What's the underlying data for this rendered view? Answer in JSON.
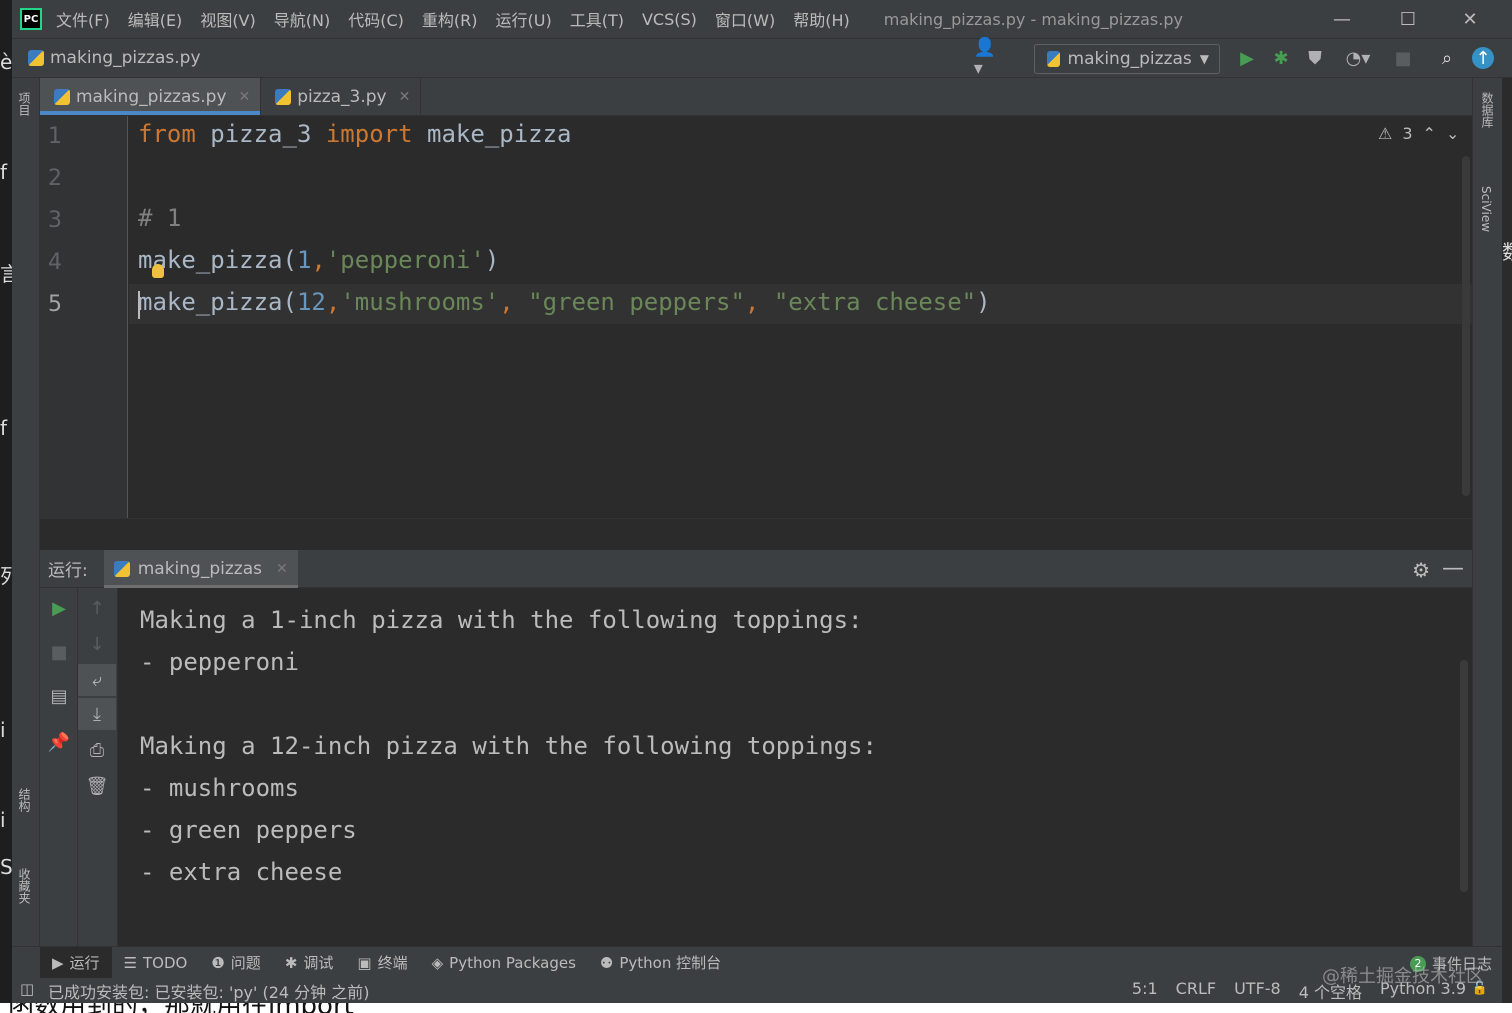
{
  "window": {
    "title": "making_pizzas.py - making_pizzas.py",
    "minimize_glyph": "—",
    "maximize_glyph": "☐",
    "close_glyph": "✕"
  },
  "menu": [
    "文件(F)",
    "编辑(E)",
    "视图(V)",
    "导航(N)",
    "代码(C)",
    "重构(R)",
    "运行(U)",
    "工具(T)",
    "VCS(S)",
    "窗口(W)",
    "帮助(H)"
  ],
  "navbar": {
    "file": "making_pizzas.py",
    "run_config": "making_pizzas"
  },
  "left_bar": {
    "project_label": "项目",
    "structure_label": "结构",
    "bookmarks_label": "收藏夹"
  },
  "right_bar": {
    "database_label": "数据库",
    "sciview_label": "SciView"
  },
  "editor_tabs": [
    {
      "label": "making_pizzas.py",
      "active": true
    },
    {
      "label": "pizza_3.py",
      "active": false
    }
  ],
  "editor": {
    "line_numbers": [
      "1",
      "2",
      "3",
      "4",
      "5"
    ],
    "warnings_count": "3",
    "lines": [
      [
        {
          "t": "from",
          "c": "kw"
        },
        {
          "t": " pizza_3 ",
          "c": ""
        },
        {
          "t": "import",
          "c": "kw"
        },
        {
          "t": " make_pizza",
          "c": ""
        }
      ],
      [],
      [
        {
          "t": "# 1",
          "c": "cmt"
        }
      ],
      [
        {
          "t": "make_pizza(",
          "c": ""
        },
        {
          "t": "1",
          "c": "num"
        },
        {
          "t": ",",
          "c": "kw"
        },
        {
          "t": "'pepperoni'",
          "c": "str"
        },
        {
          "t": ")",
          "c": ""
        }
      ],
      [
        {
          "t": "make_pizza(",
          "c": ""
        },
        {
          "t": "12",
          "c": "num"
        },
        {
          "t": ",",
          "c": "kw"
        },
        {
          "t": "'mushrooms'",
          "c": "str"
        },
        {
          "t": ", ",
          "c": "kw"
        },
        {
          "t": "\"green peppers\"",
          "c": "str"
        },
        {
          "t": ", ",
          "c": "kw"
        },
        {
          "t": "\"extra cheese\"",
          "c": "str"
        },
        {
          "t": ")",
          "c": ""
        }
      ]
    ]
  },
  "run_panel": {
    "label": "运行:",
    "tab": "making_pizzas",
    "output": [
      "Making a 1-inch pizza with the following toppings:",
      "- pepperoni",
      "",
      "Making a 12-inch pizza with the following toppings:",
      "- mushrooms",
      "- green peppers",
      "- extra cheese"
    ]
  },
  "tool_tabs": [
    {
      "label": "运行",
      "icon": "play-icon",
      "glyph": "▶"
    },
    {
      "label": "TODO",
      "icon": "list-icon",
      "glyph": "☰"
    },
    {
      "label": "问题",
      "icon": "info-icon",
      "glyph": "❶"
    },
    {
      "label": "调试",
      "icon": "bug-icon",
      "glyph": "✱"
    },
    {
      "label": "终端",
      "icon": "terminal-icon",
      "glyph": "▣"
    },
    {
      "label": "Python Packages",
      "icon": "layers-icon",
      "glyph": "◈"
    },
    {
      "label": "Python 控制台",
      "icon": "python-icon",
      "glyph": "⚉"
    }
  ],
  "event_log": {
    "count": "2",
    "label": "事件日志"
  },
  "status_bar": {
    "message": "已成功安装包: 已安装包: 'py' (24 分钟 之前)",
    "position": "5:1",
    "line_ending": "CRLF",
    "encoding": "UTF-8",
    "indent": "4 个空格",
    "interpreter": "Python 3.9"
  },
  "watermark": "@稀土掘金技术社区",
  "background_text": {
    "bottom": "函数用到的，那就用往import",
    "left_chars": [
      "è",
      "f",
      "言",
      "f",
      "列",
      "i",
      "i",
      "S"
    ],
    "right_char": "数"
  },
  "colors": {
    "keyword": "#cc7832",
    "number": "#6897bb",
    "string": "#6a8759",
    "comment": "#808080",
    "run_green": "#499c54",
    "accent_blue": "#4a88c7"
  }
}
